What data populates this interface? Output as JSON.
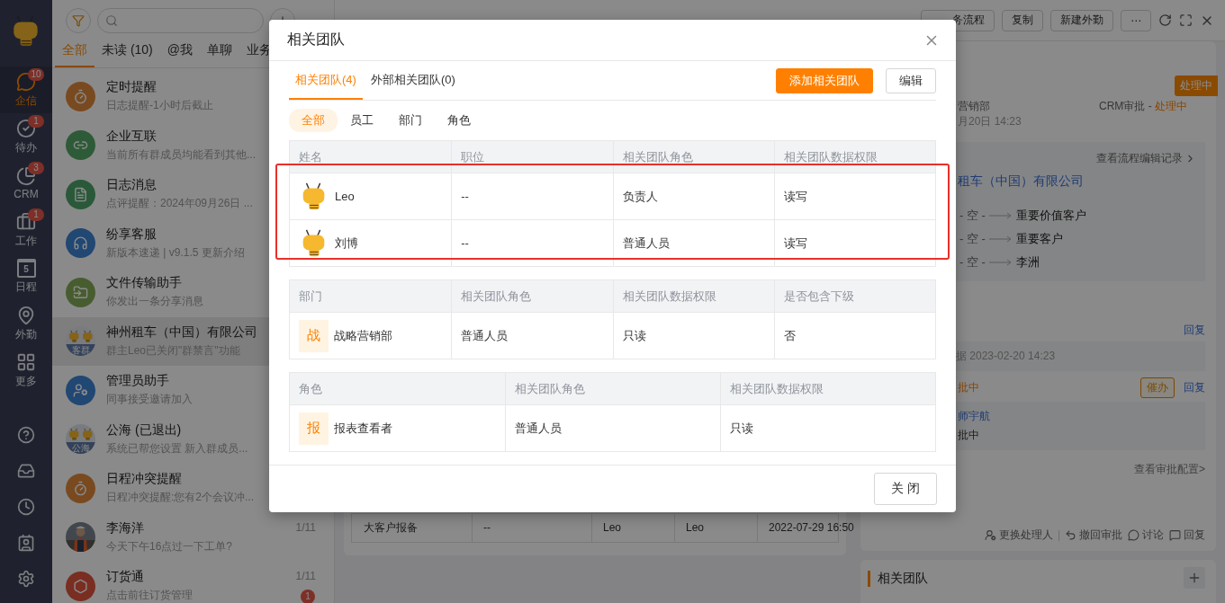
{
  "nav": {
    "items": [
      {
        "label": "企信",
        "badge": "10",
        "selected": true
      },
      {
        "label": "待办",
        "badge": "1",
        "selected": false
      },
      {
        "label": "CRM",
        "badge": "3",
        "selected": false
      },
      {
        "label": "工作",
        "badge": "1",
        "selected": false
      },
      {
        "label": "日程",
        "day": "5",
        "selected": false
      },
      {
        "label": "外勤",
        "selected": false
      },
      {
        "label": "更多",
        "selected": false
      }
    ]
  },
  "chat": {
    "tabs": [
      {
        "label": "全部",
        "selected": true
      },
      {
        "label": "未读 (10)",
        "selected": false
      },
      {
        "label": "@我",
        "selected": false
      },
      {
        "label": "单聊",
        "selected": false
      },
      {
        "label": "业务",
        "selected": false
      }
    ],
    "items": [
      {
        "kind": "icon",
        "title": "定时提醒",
        "subtitle": "日志提醒-1小时后截止",
        "selected": false
      },
      {
        "kind": "icon",
        "title": "企业互联",
        "subtitle": "当前所有群成员均能看到其他...",
        "selected": false
      },
      {
        "kind": "icon",
        "title": "日志消息",
        "subtitle": "点评提醒：2024年09月26日 ...",
        "selected": false
      },
      {
        "kind": "icon",
        "title": "纷享客服",
        "subtitle": "新版本速递 | v9.1.5 更新介绍",
        "selected": false
      },
      {
        "kind": "icon",
        "title": "文件传输助手",
        "subtitle": "你发出一条分享消息",
        "selected": false
      },
      {
        "kind": "group",
        "avatar_label": "客群",
        "title": "神州租车（中国）有限公司",
        "subtitle": "群主Leo已关闭\"群禁言\"功能",
        "selected": true
      },
      {
        "kind": "icon",
        "title": "管理员助手",
        "subtitle": "同事接受邀请加入",
        "selected": false
      },
      {
        "kind": "group",
        "avatar_label": "公海",
        "title": "公海 (已退出)",
        "subtitle": "系统已帮您设置 新入群成员...",
        "selected": false
      },
      {
        "kind": "icon",
        "title": "日程冲突提醒",
        "subtitle": "日程冲突提醒:您有2个会议冲...",
        "selected": false
      },
      {
        "title": "李海洋",
        "subtitle": "今天下午16点过一下工单?",
        "time": "1/11",
        "selected": false
      },
      {
        "kind": "icon",
        "title": "订货通",
        "subtitle": "点击前往订货管理",
        "time": "1/11",
        "badge": "1",
        "selected": false
      }
    ]
  },
  "record": {
    "header_buttons": [
      "务流程",
      "复制",
      "新建外勤",
      "⋯"
    ],
    "table_row": [
      "大客户报备",
      "--",
      "Leo",
      "Leo",
      "2022-07-29 16:50"
    ]
  },
  "approval": {
    "status_badge": "处理中",
    "department": "营销部",
    "time": "月20日 14:23",
    "flow_label": "CRM审批 - ",
    "flow_status": "处理中",
    "edit_log_link": "查看流程编辑记录",
    "company": "租车（中国）有限公司",
    "changes": [
      {
        "from": "- 空 -",
        "to": "重要价值客户"
      },
      {
        "from": "- 空 -",
        "to": "重要客户"
      },
      {
        "from": "- 空 -",
        "to": "李洲"
      }
    ],
    "reply_top": "回复",
    "submit_note": "据 2023-02-20 14:23",
    "step_status": "批中",
    "urge_button": "催办",
    "reply_step": "回复",
    "approver": "师宇航",
    "approver_status": "批中",
    "config_link": "查看审批配置>",
    "actions": [
      "更换处理人",
      "撤回审批",
      "讨论",
      "回复"
    ]
  },
  "team_card": {
    "title": "相关团队"
  },
  "modal": {
    "title": "相关团队",
    "tabs": [
      {
        "label": "相关团队(4)",
        "selected": true
      },
      {
        "label": "外部相关团队(0)",
        "selected": false
      }
    ],
    "buttons": [
      {
        "kind": "primary",
        "label": "添加相关团队"
      },
      {
        "kind": "default",
        "label": "编辑"
      }
    ],
    "filters": [
      {
        "label": "全部",
        "selected": true
      },
      {
        "label": "员工",
        "selected": false
      },
      {
        "label": "部门",
        "selected": false
      },
      {
        "label": "角色",
        "selected": false
      }
    ],
    "tables": [
      {
        "kind": "member",
        "highlighted": true,
        "columns": [
          "姓名",
          "职位",
          "相关团队角色",
          "相关团队数据权限"
        ],
        "rows": [
          {
            "cells": [
              "Leo",
              "--",
              "负责人",
              "读写"
            ]
          },
          {
            "cells": [
              "刘博",
              "--",
              "普通人员",
              "读写"
            ]
          }
        ]
      },
      {
        "kind": "tag",
        "columns": [
          "部门",
          "相关团队角色",
          "相关团队数据权限",
          "是否包含下级"
        ],
        "rows": [
          {
            "tag": "战",
            "cells": [
              "战略营销部",
              "普通人员",
              "只读",
              "否"
            ]
          }
        ]
      },
      {
        "kind": "tag",
        "columns": [
          "角色",
          "相关团队角色",
          "相关团队数据权限"
        ],
        "rows": [
          {
            "tag": "报",
            "cells": [
              "报表查看者",
              "普通人员",
              "只读"
            ]
          }
        ]
      }
    ],
    "close_button": "关 闭"
  }
}
